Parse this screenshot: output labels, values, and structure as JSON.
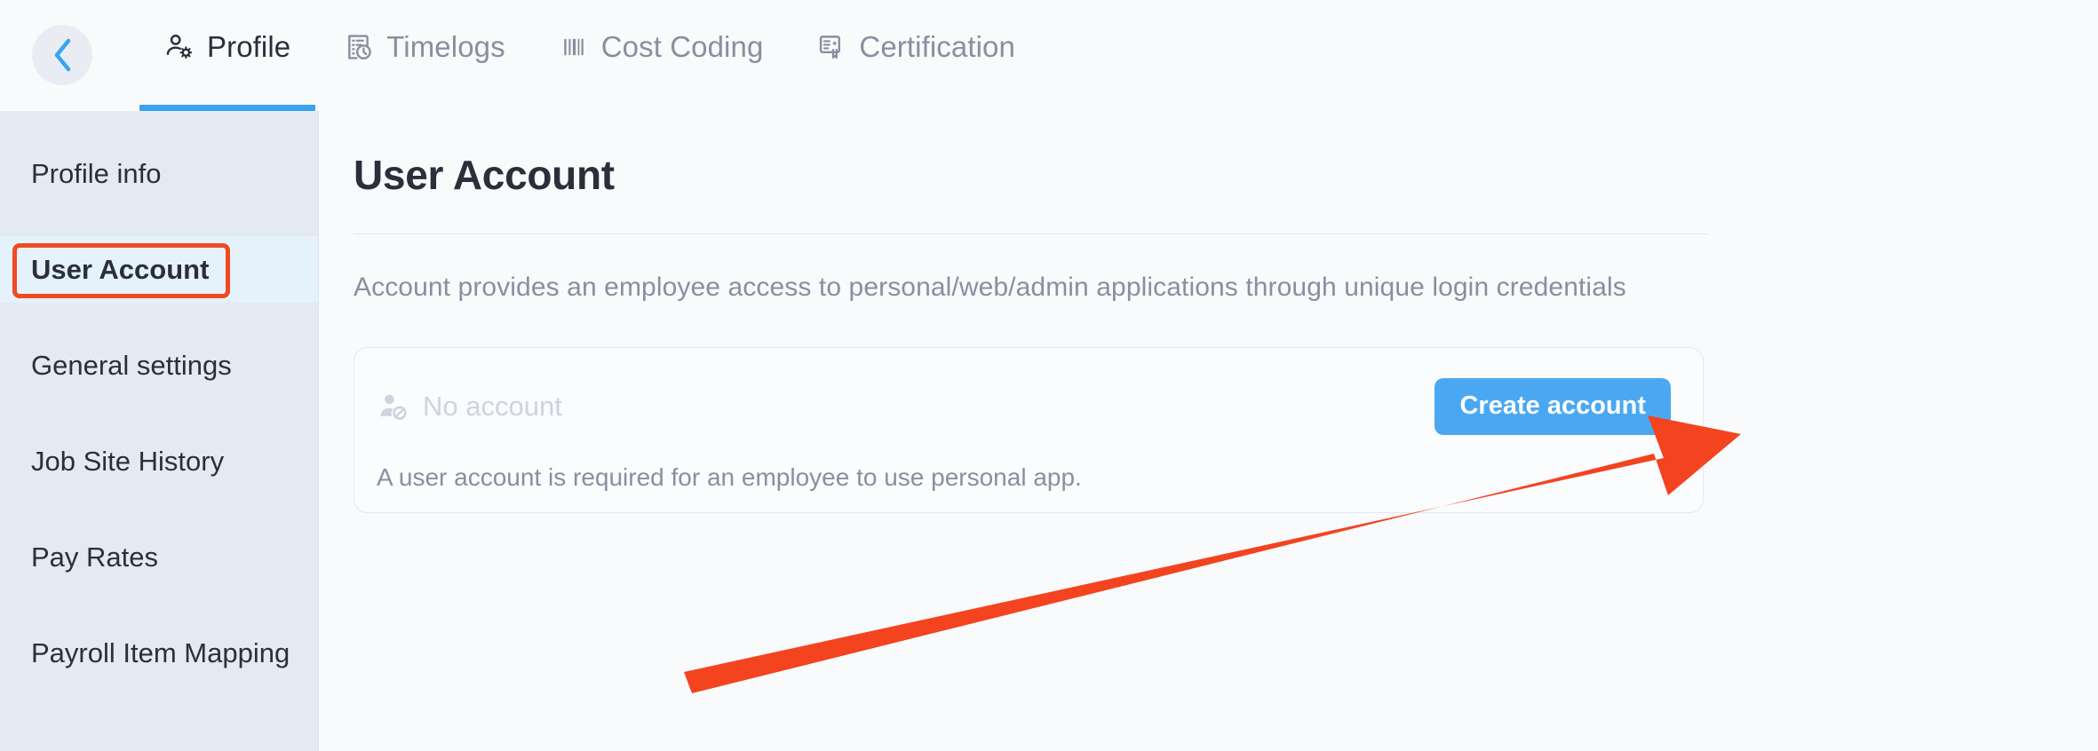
{
  "topbar": {
    "back_button": {
      "icon": "chevron-left-icon"
    },
    "tabs": [
      {
        "label": "Profile",
        "icon": "user-gear-icon",
        "active": true
      },
      {
        "label": "Timelogs",
        "icon": "clock-document-icon",
        "active": false
      },
      {
        "label": "Cost Coding",
        "icon": "barcode-icon",
        "active": false
      },
      {
        "label": "Certification",
        "icon": "certificate-icon",
        "active": false
      }
    ]
  },
  "sidebar": {
    "items": [
      {
        "label": "Profile info",
        "selected": false
      },
      {
        "label": "User Account",
        "selected": true
      },
      {
        "label": "General settings",
        "selected": false
      },
      {
        "label": "Job Site History",
        "selected": false
      },
      {
        "label": "Pay Rates",
        "selected": false
      },
      {
        "label": "Payroll Item Mapping",
        "selected": false
      }
    ]
  },
  "main": {
    "title": "User Account",
    "description": "Account provides an employee access to personal/web/admin applications through unique login credentials",
    "card": {
      "status_icon": "user-blocked-icon",
      "status_text": "No account",
      "note": "A user account is required for an employee to use personal app.",
      "create_button_label": "Create account"
    }
  },
  "annotation": {
    "highlight_color": "#f04a23",
    "arrow_color": "#f4431f",
    "accent_color": "#4aa8f2",
    "target": "create-account-button"
  }
}
